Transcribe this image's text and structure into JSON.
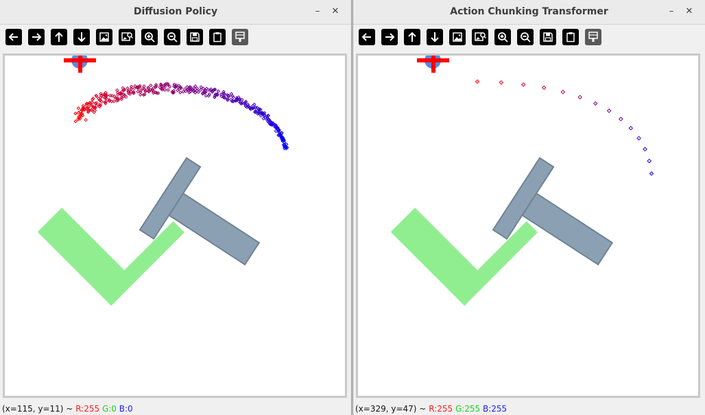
{
  "windows": [
    {
      "id": "left",
      "title": "Diffusion Policy",
      "status": {
        "coords": "(x=115, y=11) ~",
        "r": "R:255",
        "g": "G:0",
        "b": "B:0"
      }
    },
    {
      "id": "right",
      "title": "Action Chunking Transformer",
      "status": {
        "coords": "(x=329, y=47) ~",
        "r": "R:255",
        "g": "G:255",
        "b": "B:255"
      }
    }
  ],
  "window_controls": {
    "minimize": "–",
    "close": "✕"
  },
  "toolbar_icons": [
    "arrow-left-icon",
    "arrow-right-icon",
    "arrow-up-icon",
    "arrow-down-icon",
    "image-icon",
    "image-zoom-icon",
    "zoom-in-icon",
    "zoom-out-icon",
    "save-icon",
    "clipboard-icon",
    "properties-icon"
  ],
  "colors": {
    "target_t": "#90ee90",
    "block_t": "#8ba0b3",
    "block_t_edge": "#6f8394",
    "agent": "#5a8ae0",
    "cursor_cross": "#ff0000",
    "trajectory_start": "#ff0000",
    "trajectory_end": "#0000ff"
  }
}
